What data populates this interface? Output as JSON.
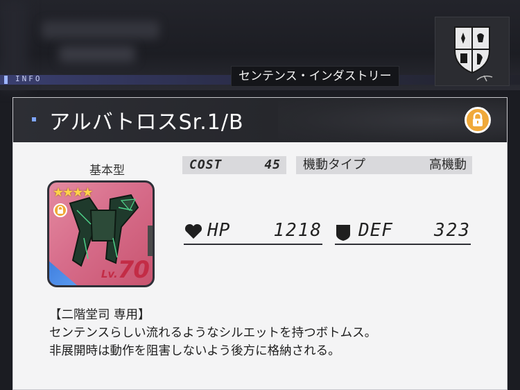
{
  "header_strip": {
    "info_label": "INFO"
  },
  "company": {
    "name": "センテンス・インダストリー"
  },
  "part": {
    "name": "アルバトロスSr.1/B",
    "type": "基本型",
    "rarity_stars": "★★★★",
    "level_prefix": "Lv.",
    "level": "70"
  },
  "stats": {
    "cost_label": "COST",
    "cost_value": "45",
    "mobility_label": "機動タイプ",
    "mobility_value": "高機動",
    "hp_label": "HP",
    "hp_value": "1218",
    "def_label": "DEF",
    "def_value": "323"
  },
  "description": {
    "tag": "【二階堂司 専用】",
    "line1": "センテンスらしい流れるようなシルエットを持つボトムス。",
    "line2": "非展開時は動作を阻害しないよう後方に格納される。"
  },
  "icons": [
    "emblem-icon",
    "lock-icon",
    "heart-icon",
    "shield-icon",
    "star-icon"
  ],
  "colors": {
    "lock_orange": "#f0a93a",
    "level_red": "#c32c46",
    "header_dark": "#2d2e34"
  }
}
